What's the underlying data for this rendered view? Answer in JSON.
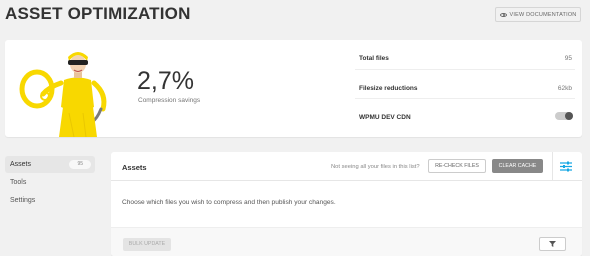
{
  "page": {
    "title": "ASSET OPTIMIZATION",
    "view_docs_label": "VIEW DOCUMENTATION"
  },
  "summary": {
    "compression_value": "2,7%",
    "compression_label": "Compression savings",
    "rows": [
      {
        "label": "Total files",
        "value": "95"
      },
      {
        "label": "Filesize reductions",
        "value": "62kb"
      },
      {
        "label": "WPMU DEV CDN",
        "toggle_on": false
      }
    ]
  },
  "nav": {
    "items": [
      {
        "label": "Assets",
        "count": "95",
        "active": true
      },
      {
        "label": "Tools"
      },
      {
        "label": "Settings"
      }
    ]
  },
  "assets": {
    "title": "Assets",
    "hint": "Not seeing all your files in this list?",
    "recheck_label": "RE-CHECK FILES",
    "clear_cache_label": "CLEAR CACHE",
    "description": "Choose which files you wish to compress and then publish your changes.",
    "bulk_update_label": "BULK UPDATE"
  },
  "colors": {
    "accent_blue": "#17a8e3",
    "mascot_yellow": "#f8d800"
  },
  "icons": [
    "eye-icon",
    "settings-sliders-icon",
    "filter-icon",
    "toggle-switch"
  ]
}
